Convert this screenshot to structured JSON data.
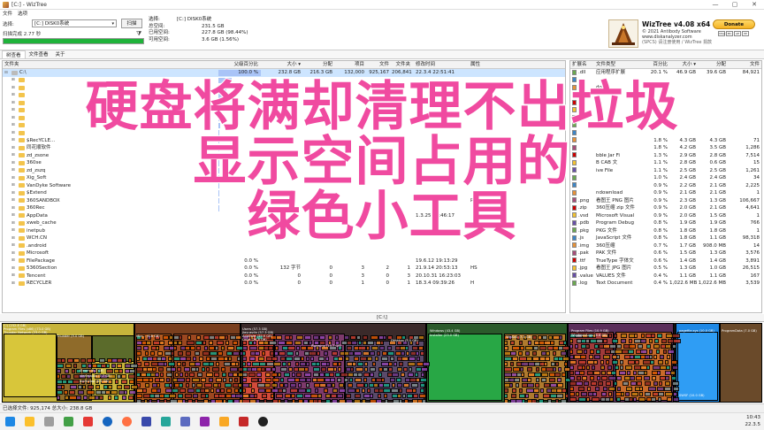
{
  "window": {
    "title": "[C:] - WizTree",
    "min": "—",
    "max": "▢",
    "close": "✕"
  },
  "menu": {
    "file": "文件",
    "options": "选项"
  },
  "top": {
    "select_label": "选择:",
    "drive_value": "[C:] DISK0系统",
    "scan_label": "扫描",
    "scan_time": "扫描完成 2.77 秒",
    "sel_label": "选择:",
    "sel_value": "[C:]  DISK0系统",
    "total_label": "总空间:",
    "total_value": "231.5 GB",
    "used_label": "已用空间:",
    "used_value": "227.8 GB  (98.44%)",
    "free_label": "可用空间:",
    "free_value": "3.6 GB  (1.56%)",
    "progress_fraction": 1.0
  },
  "brand": {
    "name": "WizTree v4.08 x64",
    "copyright": "© 2021 Antibody Software",
    "site": "www.diskanalyzer.com",
    "tagline": "(SPCS) 请注册使用 / WizTree 捐款",
    "donate": "Donate",
    "cards": [
      "VISA",
      "MC",
      "AE",
      "PP"
    ]
  },
  "tabs": [
    "树查看",
    "文件查看",
    "关于"
  ],
  "tree": {
    "headers": [
      "文件夹",
      "父级百分比",
      "大小 ▾",
      "分配",
      "项目",
      "文件",
      "文件夹",
      "修改时间",
      "属性"
    ],
    "rows": [
      {
        "name": "C:\\",
        "pct": "100.0 %",
        "pct_frac": 1.0,
        "size": "232.8 GB",
        "alloc": "216.3 GB",
        "items": "132,000",
        "files": "925,167",
        "folders": "206,841",
        "mod": "22.3.4 22:51:41",
        "attr": ""
      },
      {
        "name": "",
        "pct": "",
        "pct_frac": 0.31,
        "size": "",
        "alloc": "",
        "items": "",
        "files": "",
        "folders": "",
        "mod": "",
        "attr": ""
      },
      {
        "name": "",
        "pct": "",
        "pct_frac": 0.18,
        "size": "",
        "alloc": "",
        "items": "",
        "files": "",
        "folders": "",
        "mod": "",
        "attr": ""
      },
      {
        "name": "",
        "pct": "",
        "pct_frac": 0.12,
        "size": "",
        "alloc": "",
        "items": "",
        "files": "",
        "folders": "",
        "mod": "",
        "attr": ""
      },
      {
        "name": "",
        "pct": "",
        "pct_frac": 0.09,
        "size": "",
        "alloc": "",
        "items": "",
        "files": "",
        "folders": "",
        "mod": "",
        "attr": ""
      },
      {
        "name": "",
        "pct": "",
        "pct_frac": 0.07,
        "size": "",
        "alloc": "",
        "items": "",
        "files": "",
        "folders": "",
        "mod": "",
        "attr": ""
      },
      {
        "name": "",
        "pct": "",
        "pct_frac": 0.05,
        "size": "",
        "alloc": "",
        "items": "",
        "files": "",
        "folders": "",
        "mod": "",
        "attr": ""
      },
      {
        "name": "",
        "pct": "",
        "pct_frac": 0.04,
        "size": "",
        "alloc": "",
        "items": "",
        "files": "",
        "folders": "",
        "mod": "",
        "attr": ""
      },
      {
        "name": "",
        "pct": "",
        "pct_frac": 0.03,
        "size": "",
        "alloc": "",
        "items": "",
        "files": "",
        "folders": "",
        "mod": "",
        "attr": ""
      },
      {
        "name": "$RecYCLE...",
        "pct": "",
        "pct_frac": 0.03,
        "size": "",
        "alloc": "",
        "items": "",
        "files": "",
        "folders": "",
        "mod": "",
        "attr": ""
      },
      {
        "name": "同花顺软件",
        "pct": "",
        "pct_frac": 0.02,
        "size": "",
        "alloc": "",
        "items": "",
        "files": "",
        "folders": "",
        "mod": "",
        "attr": ""
      },
      {
        "name": "zd_zsone",
        "pct": "",
        "pct_frac": 0.02,
        "size": "",
        "alloc": "",
        "items": "",
        "files": "",
        "folders": "",
        "mod": "",
        "attr": ""
      },
      {
        "name": "360se",
        "pct": "",
        "pct_frac": 0.02,
        "size": "",
        "alloc": "",
        "items": "",
        "files": "",
        "folders": "",
        "mod": "",
        "attr": ""
      },
      {
        "name": "zd_zszq",
        "pct": "",
        "pct_frac": 0.01,
        "size": "",
        "alloc": "",
        "items": "",
        "files": "",
        "folders": "",
        "mod": "",
        "attr": ""
      },
      {
        "name": "Xig_Soft",
        "pct": "",
        "pct_frac": 0.01,
        "size": "",
        "alloc": "",
        "items": "",
        "files": "",
        "folders": "",
        "mod": "",
        "attr": ""
      },
      {
        "name": "VanDyke Software",
        "pct": "",
        "pct_frac": 0.01,
        "size": "",
        "alloc": "",
        "items": "",
        "files": "",
        "folders": "",
        "mod": "",
        "attr": ""
      },
      {
        "name": "$Extend",
        "pct": "",
        "pct_frac": 0.01,
        "size": "",
        "alloc": "",
        "items": "",
        "files": "",
        "folders": "",
        "mod": "",
        "attr": ""
      },
      {
        "name": "360SANDBOX",
        "pct": "",
        "pct_frac": 0.01,
        "size": "",
        "alloc": "",
        "items": "",
        "files": "",
        "folders": "",
        "mod": "",
        "attr": "RHS"
      },
      {
        "name": "360Rec",
        "pct": "",
        "pct_frac": 0.01,
        "size": "",
        "alloc": "",
        "items": "",
        "files": "",
        "folders": "",
        "mod": "",
        "attr": ""
      },
      {
        "name": "AppData",
        "pct": "",
        "pct_frac": 0.0,
        "size": "",
        "alloc": "",
        "items": "",
        "files": "",
        "folders": "",
        "mod": "1.3.25 21:46:17",
        "attr": ""
      },
      {
        "name": "xweb_cache",
        "pct": "",
        "pct_frac": 0.0,
        "size": "",
        "alloc": "",
        "items": "",
        "files": "",
        "folders": "",
        "mod": "",
        "attr": ""
      },
      {
        "name": "inetpub",
        "pct": "",
        "pct_frac": 0.0,
        "size": "",
        "alloc": "",
        "items": "",
        "files": "",
        "folders": "",
        "mod": "",
        "attr": ""
      },
      {
        "name": "WCH.CN",
        "pct": "",
        "pct_frac": 0.0,
        "size": "",
        "alloc": "",
        "items": "",
        "files": "",
        "folders": "",
        "mod": "",
        "attr": ""
      },
      {
        "name": ".android",
        "pct": "",
        "pct_frac": 0.0,
        "size": "",
        "alloc": "",
        "items": "",
        "files": "",
        "folders": "",
        "mod": "",
        "attr": ""
      },
      {
        "name": "Microsoft",
        "pct": "",
        "pct_frac": 0.0,
        "size": "",
        "alloc": "",
        "items": "",
        "files": "",
        "folders": "",
        "mod": "",
        "attr": ""
      },
      {
        "name": "FilePackage",
        "pct": "0.0 %",
        "pct_frac": 0.0,
        "size": "",
        "alloc": "",
        "items": "",
        "files": "",
        "folders": "",
        "mod": "19.6.12 19:13:29",
        "attr": ""
      },
      {
        "name": "5360Section",
        "pct": "0.0 %",
        "pct_frac": 0.0,
        "size": "132 字节",
        "alloc": "0",
        "items": "3",
        "files": "2",
        "folders": "1",
        "mod": "21.9.14 20:53:13",
        "attr": "HS"
      },
      {
        "name": "Tencent",
        "pct": "0.0 %",
        "pct_frac": 0.0,
        "size": "0",
        "alloc": "0",
        "items": "3",
        "files": "0",
        "folders": "3",
        "mod": "20.10.31 16:23:03",
        "attr": ""
      },
      {
        "name": "RECYCLER",
        "pct": "0.0 %",
        "pct_frac": 0.0,
        "size": "0",
        "alloc": "0",
        "items": "1",
        "files": "0",
        "folders": "1",
        "mod": "18.3.4 09:39:26",
        "attr": "H"
      }
    ]
  },
  "ext": {
    "headers": [
      "扩展名",
      "文件类型",
      "百分比",
      "大小 ▾",
      "分配",
      "文件"
    ],
    "rows": [
      {
        "ext": ".dll",
        "type": "应用程序扩展",
        "pct": "20.1 %",
        "size": "46.9 GB",
        "alloc": "39.6 GB",
        "files": "84,921"
      },
      {
        "ext": "",
        "type": "",
        "pct": "",
        "size": "",
        "alloc": "",
        "files": ""
      },
      {
        "ext": "",
        "type": "dows",
        "pct": "",
        "size": "",
        "alloc": "",
        "files": ""
      },
      {
        "ext": "",
        "type": "",
        "pct": "",
        "size": "",
        "alloc": "",
        "files": ""
      },
      {
        "ext": "",
        "type": "",
        "pct": "",
        "size": "",
        "alloc": "",
        "files": ""
      },
      {
        "ext": "",
        "type": "",
        "pct": "",
        "size": "",
        "alloc": "",
        "files": ""
      },
      {
        "ext": "",
        "type": "",
        "pct": "",
        "size": "",
        "alloc": "",
        "files": ""
      },
      {
        "ext": "",
        "type": "",
        "pct": "",
        "size": "",
        "alloc": "",
        "files": ""
      },
      {
        "ext": "",
        "type": "",
        "pct": "",
        "size": "",
        "alloc": "",
        "files": ""
      },
      {
        "ext": "",
        "type": "",
        "pct": "1.8 %",
        "size": "4.3 GB",
        "alloc": "4.3 GB",
        "files": "71"
      },
      {
        "ext": "",
        "type": "",
        "pct": "1.8 %",
        "size": "4.2 GB",
        "alloc": "3.5 GB",
        "files": "1,286"
      },
      {
        "ext": "",
        "type": "bble Jar Fi",
        "pct": "1.3 %",
        "size": "2.9 GB",
        "alloc": "2.8 GB",
        "files": "7,514"
      },
      {
        "ext": "",
        "type": "B CAB 文",
        "pct": "1.1 %",
        "size": "2.8 GB",
        "alloc": "0.6 GB",
        "files": "15"
      },
      {
        "ext": "",
        "type": "ive File",
        "pct": "1.1 %",
        "size": "2.5 GB",
        "alloc": "2.5 GB",
        "files": "1,261"
      },
      {
        "ext": "",
        "type": "",
        "pct": "1.0 %",
        "size": "2.4 GB",
        "alloc": "2.4 GB",
        "files": "34"
      },
      {
        "ext": "",
        "type": "",
        "pct": "0.9 %",
        "size": "2.2 GB",
        "alloc": "2.1 GB",
        "files": "2,225"
      },
      {
        "ext": "",
        "type": "ndownload",
        "pct": "0.9 %",
        "size": "2.1 GB",
        "alloc": "2.1 GB",
        "files": "1"
      },
      {
        "ext": ".png",
        "type": "看图王 PNG 图片",
        "pct": "0.9 %",
        "size": "2.3 GB",
        "alloc": "1.3 GB",
        "files": "106,667"
      },
      {
        "ext": ".zip",
        "type": "360压缩 zip 文件",
        "pct": "0.9 %",
        "size": "2.0 GB",
        "alloc": "2.1 GB",
        "files": "4,641"
      },
      {
        "ext": ".vsd",
        "type": "Microsoft Visual",
        "pct": "0.9 %",
        "size": "2.0 GB",
        "alloc": "1.5 GB",
        "files": "1"
      },
      {
        "ext": ".pdb",
        "type": "Program Debug",
        "pct": "0.8 %",
        "size": "1.9 GB",
        "alloc": "1.9 GB",
        "files": "766"
      },
      {
        "ext": ".pkg",
        "type": "PKG 文件",
        "pct": "0.8 %",
        "size": "1.8 GB",
        "alloc": "1.8 GB",
        "files": "1"
      },
      {
        "ext": ".js",
        "type": "JavaScript 文件",
        "pct": "0.8 %",
        "size": "1.8 GB",
        "alloc": "1.1 GB",
        "files": "98,318"
      },
      {
        "ext": ".img",
        "type": "360压缩",
        "pct": "0.7 %",
        "size": "1.7 GB",
        "alloc": "908.0 MB",
        "files": "14"
      },
      {
        "ext": ".pak",
        "type": "PAK 文件",
        "pct": "0.6 %",
        "size": "1.5 GB",
        "alloc": "1.3 GB",
        "files": "3,576"
      },
      {
        "ext": ".ttf",
        "type": "TrueType 字体文",
        "pct": "0.6 %",
        "size": "1.4 GB",
        "alloc": "1.4 GB",
        "files": "3,891"
      },
      {
        "ext": ".jpg",
        "type": "看图王 JPG 图片",
        "pct": "0.5 %",
        "size": "1.3 GB",
        "alloc": "1.0 GB",
        "files": "26,515"
      },
      {
        "ext": ".value",
        "type": "VALUES 文件",
        "pct": "0.4 %",
        "size": "1.1 GB",
        "alloc": "1.1 GB",
        "files": "167"
      },
      {
        "ext": ".log",
        "type": "Text Document",
        "pct": "0.4 %",
        "size": "1,022.6 MB",
        "alloc": "1,022.6 MB",
        "files": "3,539"
      }
    ]
  },
  "pathbar": "[C:\\]",
  "treemap": {
    "labels": [
      {
        "id": "c",
        "text": "C:\\ (232.8 GB)"
      },
      {
        "id": "pfx86",
        "text": "Program Files (x86) (73.0 GB)"
      },
      {
        "id": "thunder",
        "text": "Thunder Network (23.0 GB)"
      },
      {
        "id": "thunder2",
        "text": "Thunder (9.0 GB)"
      },
      {
        "id": "micro",
        "text": "Micr... (6.8 GB)"
      },
      {
        "id": "users",
        "text": "Users (57.3 GB)"
      },
      {
        "id": "jiayue",
        "text": "jiayuezlin (57.3 GB)"
      },
      {
        "id": "appdata",
        "text": "AppData (49.0 GB)"
      },
      {
        "id": "local",
        "text": "Local (28.8 GB)"
      },
      {
        "id": "roaming",
        "text": "Roaming (15.7 GB)"
      },
      {
        "id": "desktop",
        "text": "Desktop (5.5 GB)"
      },
      {
        "id": "windows",
        "text": "Windows (43.4 GB)"
      },
      {
        "id": "installer",
        "text": "Installer (23.0 GB)"
      },
      {
        "id": "winsxs",
        "text": "WinSxS (7.3 GB)"
      },
      {
        "id": "pf",
        "text": "Program Files (10.9 GB)"
      },
      {
        "id": "winapps",
        "text": "WindowsApps (6.8 GB)"
      },
      {
        "id": "pagefile",
        "text": "pagefile.sys (10.0 GB)"
      },
      {
        "id": "progdata",
        "text": "ProgramData (7.0 GB)"
      },
      {
        "id": "steam",
        "text": "Steam (8.7 GB)"
      },
      {
        "id": "steamapps",
        "text": "steamapps (7.7 GB)"
      },
      {
        "id": "workshop",
        "text": "workshop (6.5 GB)"
      },
      {
        "id": "swsfl",
        "text": "SWSF (10.0 GB)"
      }
    ]
  },
  "status": "已选择文件: 925,174  总大小: 238.8 GB",
  "clock": {
    "time": "10:43",
    "date": "22.3.5"
  },
  "overlay": [
    "硬盘将满却清理不出垃圾",
    "显示空间占用的",
    "绿色小工具"
  ],
  "colors": {
    "accent_green": "#1fb33a",
    "overlay_pink": "#f04aa0",
    "selection": "#cde5ff"
  }
}
